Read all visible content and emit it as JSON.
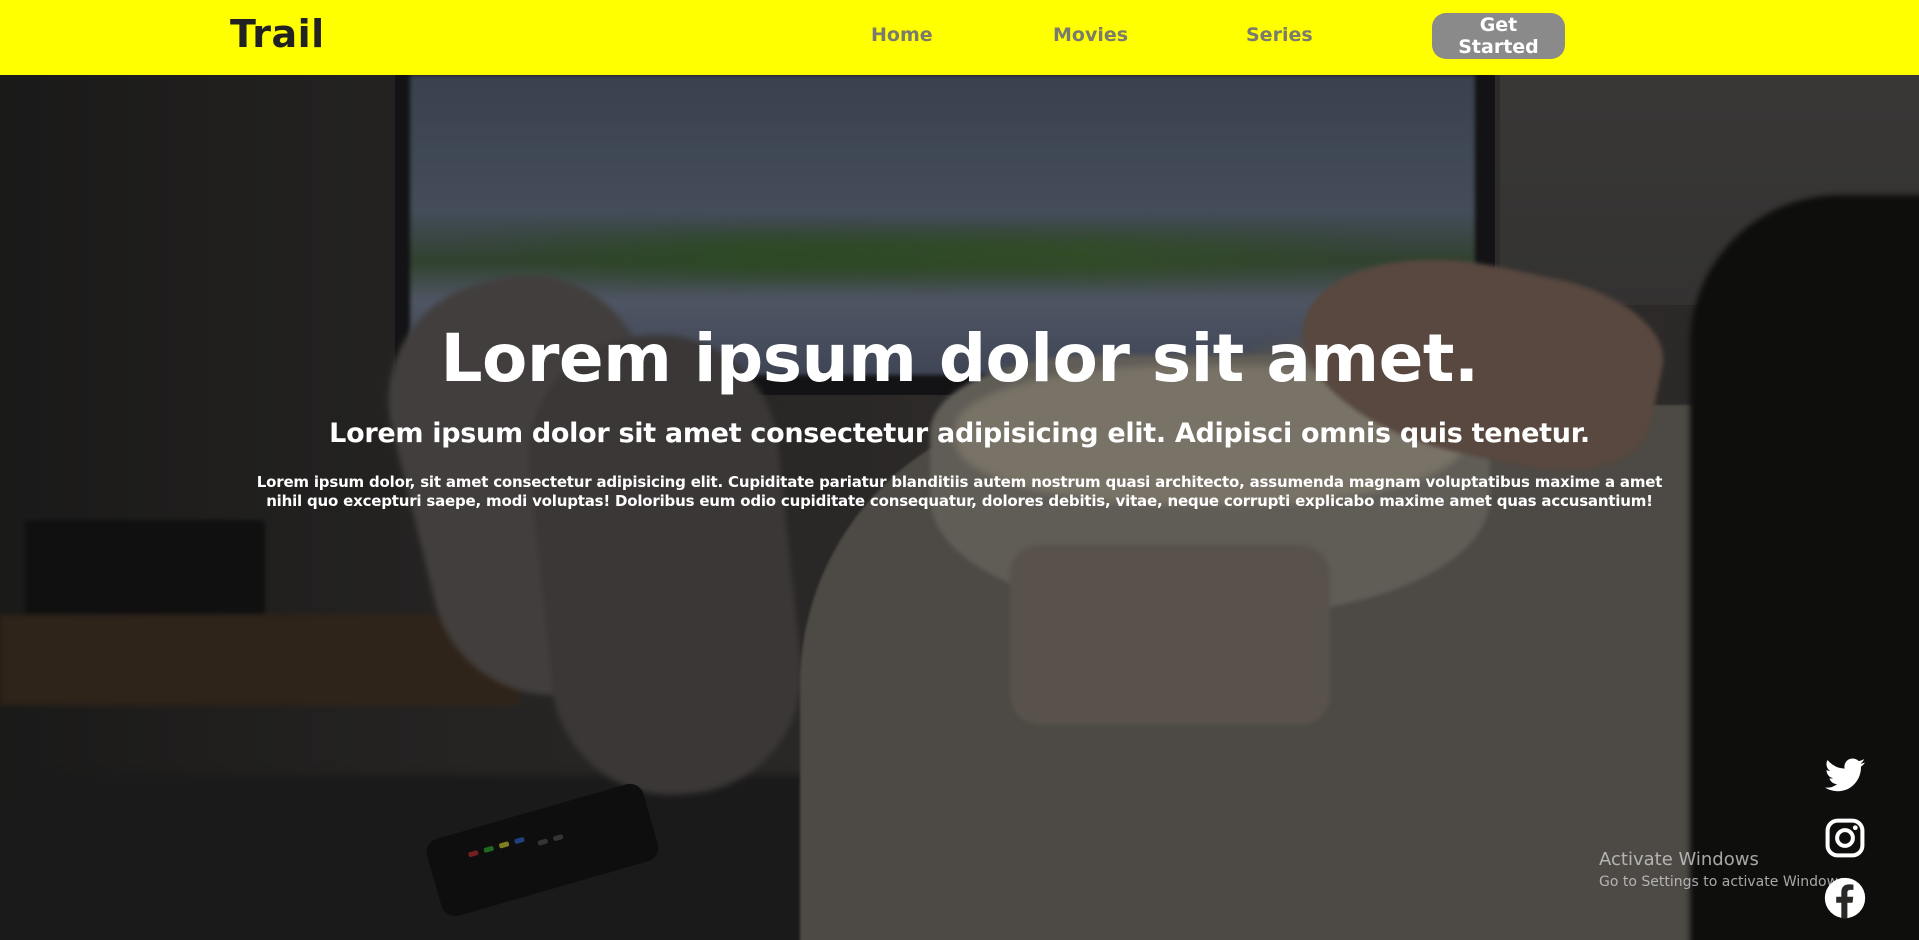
{
  "navbar": {
    "brand": "Trail",
    "links": [
      {
        "label": "Home"
      },
      {
        "label": "Movies"
      },
      {
        "label": "Series"
      }
    ],
    "cta_label": "Get Started",
    "background_color": "#ffff00"
  },
  "hero": {
    "title": "Lorem ipsum dolor sit amet.",
    "subtitle": "Lorem ipsum dolor sit amet consectetur adipisicing elit. Adipisci omnis quis tenetur.",
    "body": "Lorem ipsum dolor, sit amet consectetur adipisicing elit. Cupiditate pariatur blanditiis autem nostrum quasi architecto, assumenda magnam voluptatibus maxime a amet nihil quo excepturi saepe, modi voluptas! Doloribus eum odio cupiditate consequatur, dolores debitis, vitae, neque corrupti explicabo maxime amet quas accusantium!",
    "background_image": "photo of person on sofa holding popcorn bowl in front of a TV"
  },
  "social": [
    {
      "icon": "twitter-icon"
    },
    {
      "icon": "instagram-icon"
    },
    {
      "icon": "facebook-icon"
    }
  ],
  "watermark": {
    "title": "Activate Windows",
    "subtitle": "Go to Settings to activate Windows."
  }
}
